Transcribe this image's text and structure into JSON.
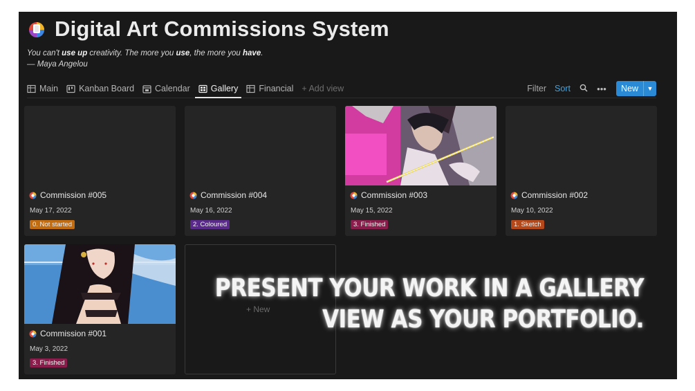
{
  "page": {
    "title": "Digital Art Commissions System",
    "quote_parts": [
      "You can't ",
      "use up",
      " creativity. The more you ",
      "use",
      ", the more you ",
      "have",
      "."
    ],
    "quote_author": "— Maya Angelou"
  },
  "views": [
    {
      "label": "Main",
      "icon": "table-icon"
    },
    {
      "label": "Kanban Board",
      "icon": "board-icon"
    },
    {
      "label": "Calendar",
      "icon": "calendar-icon"
    },
    {
      "label": "Gallery",
      "icon": "gallery-icon",
      "active": true
    },
    {
      "label": "Financial",
      "icon": "table-icon"
    }
  ],
  "add_view_label": "+ Add view",
  "toolbar": {
    "filter_label": "Filter",
    "sort_label": "Sort",
    "new_label": "New"
  },
  "cards": [
    {
      "name": "Commission #005",
      "date": "May 17, 2022",
      "status": "0. Not started",
      "status_color": "#c26c11",
      "cover": "empty"
    },
    {
      "name": "Commission #004",
      "date": "May 16, 2022",
      "status": "2. Coloured",
      "status_color": "#5a2a8a",
      "cover": "empty"
    },
    {
      "name": "Commission #003",
      "date": "May 15, 2022",
      "status": "3. Finished",
      "status_color": "#8a1c4c",
      "cover": "anime-swordsman"
    },
    {
      "name": "Commission #002",
      "date": "May 10, 2022",
      "status": "1. Sketch",
      "status_color": "#b5481a",
      "cover": "empty"
    },
    {
      "name": "Commission #001",
      "date": "May 3, 2022",
      "status": "3. Finished",
      "status_color": "#8a1c4c",
      "cover": "anime-woman"
    }
  ],
  "new_card_label": "+ New",
  "promo_lines": [
    "PRESENT YOUR WORK IN A GALLERY",
    "VIEW AS YOUR PORTFOLIO."
  ],
  "colors": {
    "background": "#191919",
    "card": "#252525",
    "accent": "#2a8ad6",
    "sort": "#3aa4e8"
  }
}
